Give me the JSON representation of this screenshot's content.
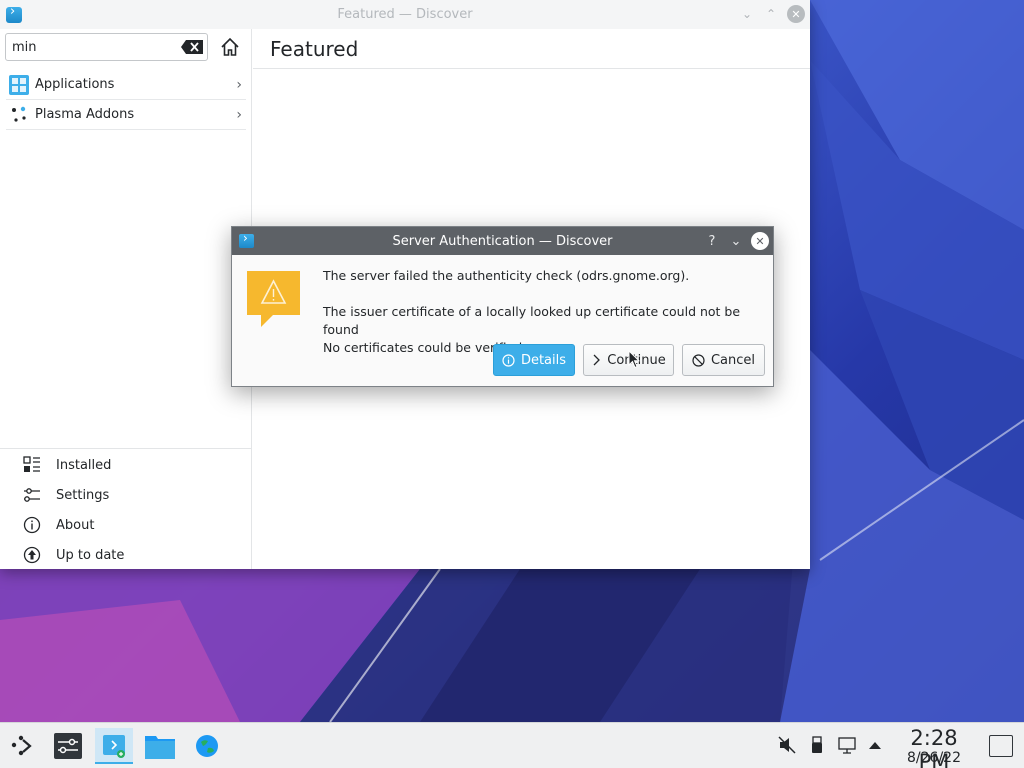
{
  "discover_window": {
    "title": "Featured — Discover",
    "search": {
      "value": "min",
      "placeholder": ""
    },
    "categories": [
      {
        "label": "Applications",
        "icon": "applications-grid-icon"
      },
      {
        "label": "Plasma Addons",
        "icon": "plasma-addons-icon"
      }
    ],
    "bottom_nav": [
      {
        "label": "Installed",
        "icon": "installed-list-icon"
      },
      {
        "label": "Settings",
        "icon": "settings-sliders-icon"
      },
      {
        "label": "About",
        "icon": "info-icon"
      },
      {
        "label": "Up to date",
        "icon": "update-arrow-icon"
      }
    ],
    "page_title": "Featured"
  },
  "dialog": {
    "title": "Server Authentication — Discover",
    "message_line1": "The server failed the authenticity check (odrs.gnome.org).",
    "message_line2": "The issuer certificate of a locally looked up certificate could not be found",
    "message_line3": "No certificates could be verified",
    "buttons": {
      "details": "Details",
      "continue": "Continue",
      "cancel": "Cancel"
    },
    "help_glyph": "?"
  },
  "taskbar": {
    "clock_time": "2:28 PM",
    "clock_date": "8/26/22"
  },
  "colors": {
    "accent": "#3daee9",
    "dialog_titlebar": "#5d6166",
    "warning": "#f6b82e"
  }
}
